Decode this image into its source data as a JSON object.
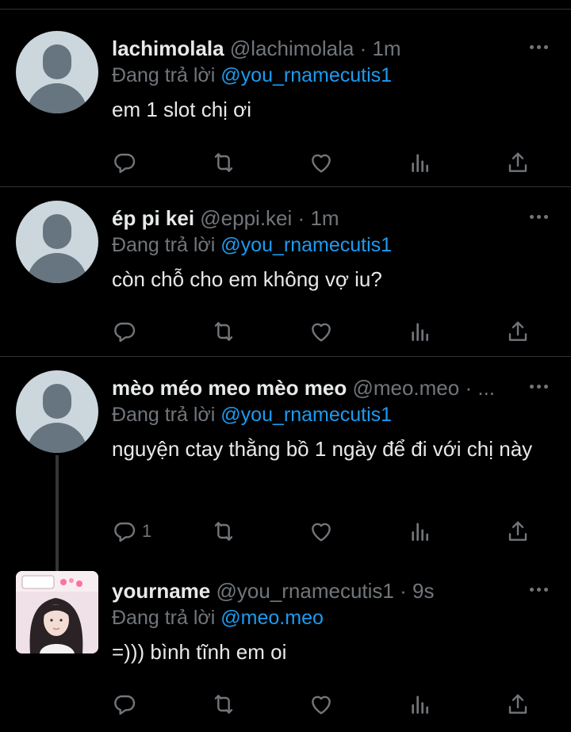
{
  "tweets": [
    {
      "name": "lachimolala",
      "handle": "@lachimolala",
      "sep": "·",
      "time": "1m",
      "reply_prefix": "Đang trả lời",
      "reply_mention": "@you_rnamecutis1",
      "text": "em 1 slot chị ơi",
      "reply_count": ""
    },
    {
      "name": "ép pi kei",
      "handle": "@eppi.kei",
      "sep": "·",
      "time": "1m",
      "reply_prefix": "Đang trả lời",
      "reply_mention": "@you_rnamecutis1",
      "text": "còn chỗ cho em không vợ iu?",
      "reply_count": ""
    },
    {
      "name": "mèo méo meo mèo meo",
      "handle": "@meo.meo",
      "sep": "·",
      "time": "...",
      "reply_prefix": "Đang trả lời",
      "reply_mention": "@you_rnamecutis1",
      "text": "nguyện ctay thằng bồ 1 ngày để đi với chị này",
      "reply_count": "1"
    },
    {
      "name": "yourname",
      "handle": "@you_rnamecutis1",
      "sep": "·",
      "time": "9s",
      "reply_prefix": "Đang trả lời",
      "reply_mention": "@meo.meo",
      "text": "=))) bình tĩnh em oi",
      "reply_count": ""
    }
  ],
  "icons": {
    "reply": "reply-icon",
    "retweet": "retweet-icon",
    "like": "heart-icon",
    "views": "views-icon",
    "share": "share-icon",
    "more": "more-icon"
  },
  "colors": {
    "background": "#000000",
    "text": "#e7e9ea",
    "muted": "#71767b",
    "mention": "#1d9bf0",
    "divider": "#2f3336"
  }
}
